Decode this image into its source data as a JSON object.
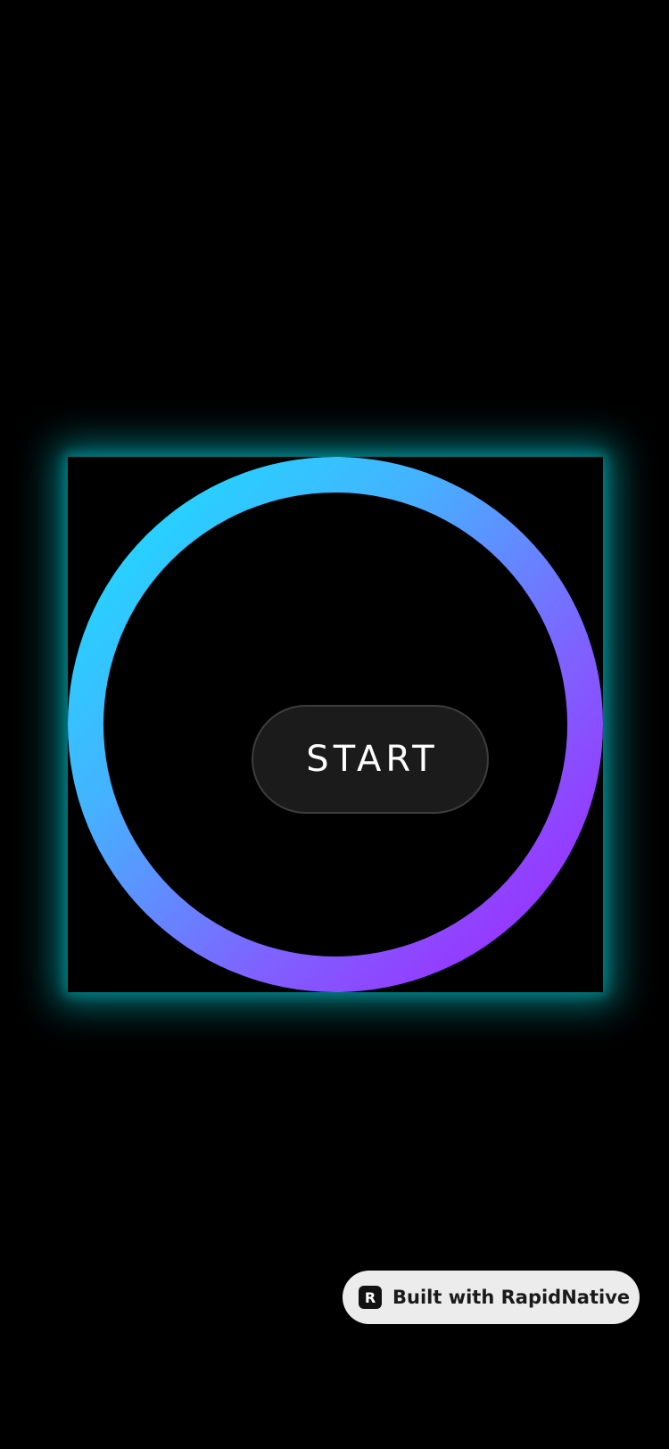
{
  "main": {
    "start_label": "START"
  },
  "badge": {
    "icon": "rapidnative-logo-icon",
    "icon_glyph": "R",
    "label": "Built with RapidNative"
  },
  "colors": {
    "background": "#000000",
    "glow": "#00969b",
    "ring_start": "#12e6ff",
    "ring_end": "#a61bff",
    "button_fill": "#1b1b1b"
  }
}
